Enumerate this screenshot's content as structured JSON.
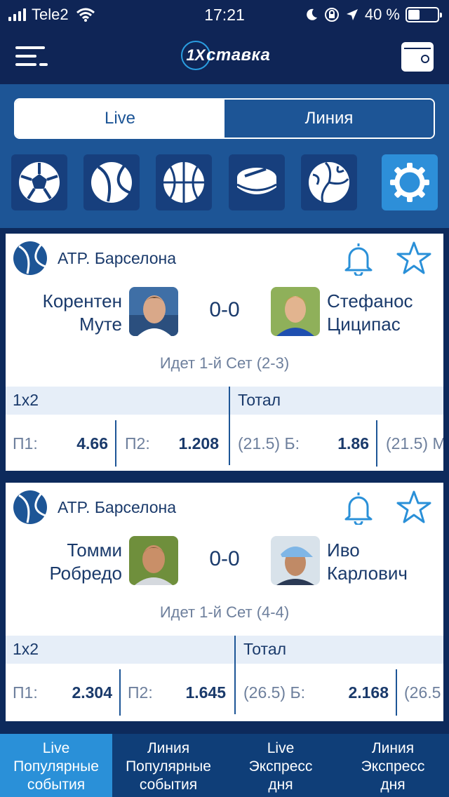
{
  "status_bar": {
    "carrier": "Tele2",
    "time": "17:21",
    "battery": "40 %",
    "battery_level": 0.4
  },
  "header": {
    "logo_mark": "1X",
    "logo_text": "ставка",
    "menu_icon": "hamburger-menu-icon",
    "wallet_icon": "wallet-icon"
  },
  "segment": {
    "live": "Live",
    "line": "Линия",
    "selected": "live"
  },
  "sports": [
    {
      "icon": "soccer-ball-icon"
    },
    {
      "icon": "tennis-ball-icon"
    },
    {
      "icon": "basketball-icon"
    },
    {
      "icon": "hockey-puck-icon"
    },
    {
      "icon": "volleyball-icon"
    },
    {
      "icon": "settings-gear-icon"
    }
  ],
  "events": [
    {
      "league": "ATP. Барселона",
      "team1": {
        "line1": "Корентен",
        "line2": "Муте"
      },
      "team2": {
        "line1": "Стефанос",
        "line2": "Циципас"
      },
      "score": "0-0",
      "status": "Идет 1-й  Сет (2-3)",
      "market1": "1x2",
      "market2": "Тотал",
      "odds": [
        {
          "label": "П1:",
          "value": "4.66"
        },
        {
          "label": "П2:",
          "value": "1.208"
        },
        {
          "label": "(21.5) Б:",
          "value": "1.86"
        },
        {
          "label": "(21.5) М",
          "value": ""
        }
      ]
    },
    {
      "league": "ATP. Барселона",
      "team1": {
        "line1": "Томми",
        "line2": "Робредо"
      },
      "team2": {
        "line1": "Иво",
        "line2": "Карлович"
      },
      "score": "0-0",
      "status": "Идет 1-й  Сет (4-4)",
      "market1": "1x2",
      "market2": "Тотал",
      "odds": [
        {
          "label": "П1:",
          "value": "2.304"
        },
        {
          "label": "П2:",
          "value": "1.645"
        },
        {
          "label": "(26.5) Б:",
          "value": "2.168"
        },
        {
          "label": "(26.5",
          "value": ""
        }
      ]
    }
  ],
  "tabs": [
    {
      "line1": "Live",
      "line2": "Популярные",
      "line3": "события"
    },
    {
      "line1": "Линия",
      "line2": "Популярные",
      "line3": "события"
    },
    {
      "line1": "Live",
      "line2": "Экспресс",
      "line3": "дня"
    },
    {
      "line1": "Линия",
      "line2": "Экспресс",
      "line3": "дня"
    }
  ],
  "colors": {
    "header": "#0f2556",
    "controls": "#1d5596",
    "accent": "#2a90d8",
    "text": "#1a3a6b",
    "muted": "#6d7f9c"
  }
}
